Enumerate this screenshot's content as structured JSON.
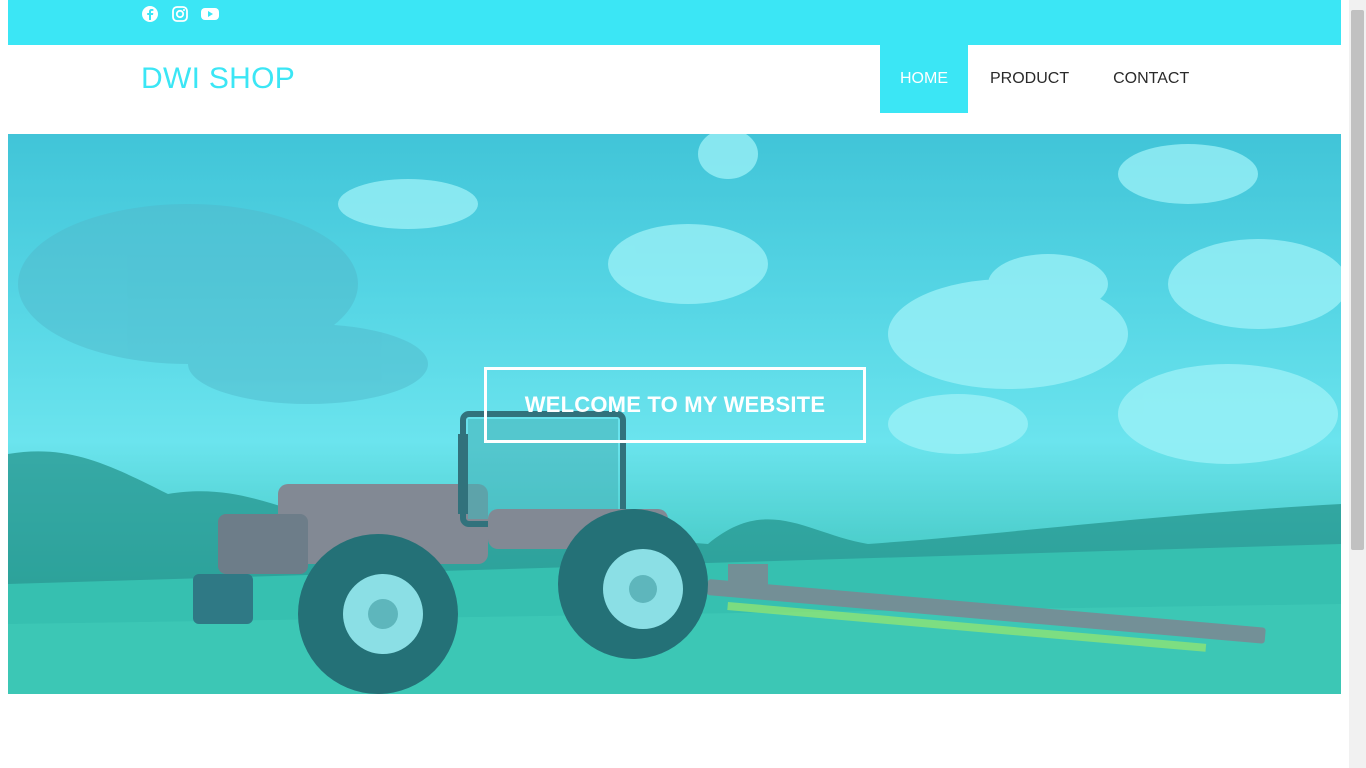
{
  "social": {
    "icons": [
      "facebook-icon",
      "instagram-icon",
      "youtube-icon"
    ],
    "color": "#ffffff"
  },
  "brand": {
    "name": "DWI SHOP",
    "color": "#3be6f5"
  },
  "nav": {
    "items": [
      {
        "label": "HOME",
        "active": true
      },
      {
        "label": "PRODUCT",
        "active": false
      },
      {
        "label": "CONTACT",
        "active": false
      }
    ],
    "active_color": "#3be6f5"
  },
  "hero": {
    "heading": "WELCOME TO MY WEBSITE",
    "overlay_color": "#3be6f5"
  },
  "colors": {
    "topbar": "#3be6f5",
    "accent": "#3be6f5"
  }
}
